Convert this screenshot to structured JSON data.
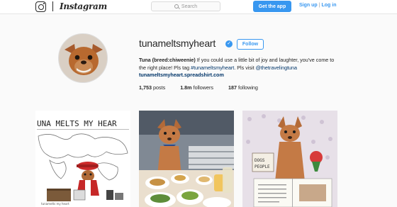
{
  "header": {
    "wordmark": "Instagram",
    "search_placeholder": "Search",
    "get_app_label": "Get the app",
    "signup_label": "Sign up",
    "separator": "|",
    "login_label": "Log in",
    "accent_color": "#3897f0"
  },
  "profile": {
    "username": "tunameltsmyheart",
    "verified_icon": "verified-badge-icon",
    "follow_label": "Follow",
    "bio": {
      "name": "Tuna (breed:chiweenie)",
      "text_1": " If you could use a little bit of joy and laughter, you've come to the right place! Pls tag ",
      "hashtag": "#tunameltsmyheart",
      "text_2": ". Pls visit ",
      "mention": "@thetravelingtuna",
      "website": "tunameltsmyheart.spreadshirt.com"
    },
    "stats": {
      "posts_value": "1,753",
      "posts_label": "posts",
      "followers_value": "1.8m",
      "followers_label": "followers",
      "following_value": "187",
      "following_label": "following"
    }
  },
  "posts": [
    {
      "image": "dog-world-map-photo",
      "overlay_text": "UNA MELTS MY HEAR",
      "caption_text": "tunamelts my heart"
    },
    {
      "image": "dog-at-brunch-table-photo"
    },
    {
      "image": "dog-with-book-in-bed-photo",
      "sign_text_1": "DOGS",
      "sign_text_2": "PEOPLE"
    }
  ]
}
